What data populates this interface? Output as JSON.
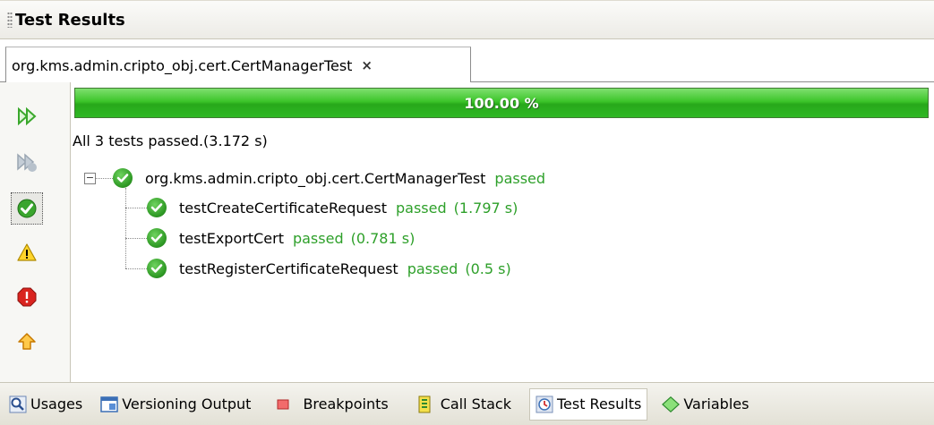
{
  "window": {
    "title": "Test Results"
  },
  "tab": {
    "label": "org.kms.admin.cripto_obj.cert.CertManagerTest",
    "close": "×"
  },
  "progress": {
    "text": "100.00 %",
    "fraction": 1.0,
    "color": "#2fb824"
  },
  "summary": "All 3 tests passed.(3.172 s)",
  "tree": {
    "expander": "−",
    "root": {
      "name": "org.kms.admin.cripto_obj.cert.CertManagerTest",
      "status": "passed"
    },
    "children": [
      {
        "name": "testCreateCertificateRequest",
        "status": "passed",
        "time": "(1.797 s)"
      },
      {
        "name": "testExportCert",
        "status": "passed",
        "time": "(0.781 s)"
      },
      {
        "name": "testRegisterCertificateRequest",
        "status": "passed",
        "time": "(0.5 s)"
      }
    ]
  },
  "toolbar": {
    "buttons": [
      {
        "icon": "rerun-icon"
      },
      {
        "icon": "rerun-failed-icon"
      },
      {
        "icon": "show-passed-icon",
        "selected": true
      },
      {
        "icon": "show-warnings-icon"
      },
      {
        "icon": "show-errors-icon"
      },
      {
        "icon": "previous-failure-icon"
      }
    ]
  },
  "bottom_tabs": [
    {
      "label": "Usages",
      "icon": "magnifier-icon"
    },
    {
      "label": "Versioning Output",
      "icon": "output-window-icon"
    },
    {
      "label": "Breakpoints",
      "icon": "breakpoint-icon"
    },
    {
      "label": "Call Stack",
      "icon": "call-stack-icon"
    },
    {
      "label": "Test Results",
      "icon": "test-results-icon",
      "active": true
    },
    {
      "label": "Variables",
      "icon": "variables-icon"
    }
  ],
  "colors": {
    "passed": "#2ea02a",
    "progress": "#2fb824"
  }
}
